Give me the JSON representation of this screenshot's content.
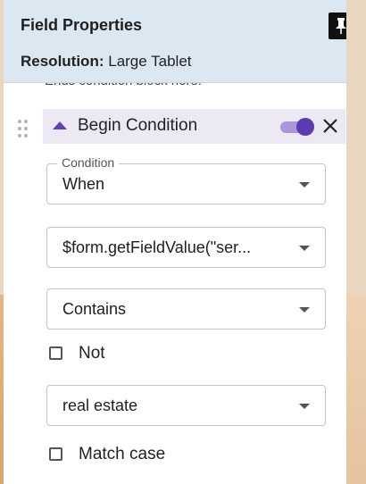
{
  "panel": {
    "title": "Field Properties",
    "resolution_label": "Resolution:",
    "resolution_value": "Large Tablet",
    "truncated_text": "Ends condition block here."
  },
  "condition_block": {
    "title": "Begin Condition",
    "enabled": true
  },
  "condition_select": {
    "label": "Condition",
    "value": "When"
  },
  "expression_select": {
    "value": "$form.getFieldValue(\"ser..."
  },
  "operator_select": {
    "value": "Contains"
  },
  "not_checkbox": {
    "label": "Not",
    "checked": false
  },
  "value_select": {
    "value": "real estate"
  },
  "match_case_checkbox": {
    "label": "Match case",
    "checked": false
  },
  "colors": {
    "header_bg": "#dbe7f1",
    "accent": "#5b3bb1",
    "condition_header_bg": "#ece8f4"
  }
}
